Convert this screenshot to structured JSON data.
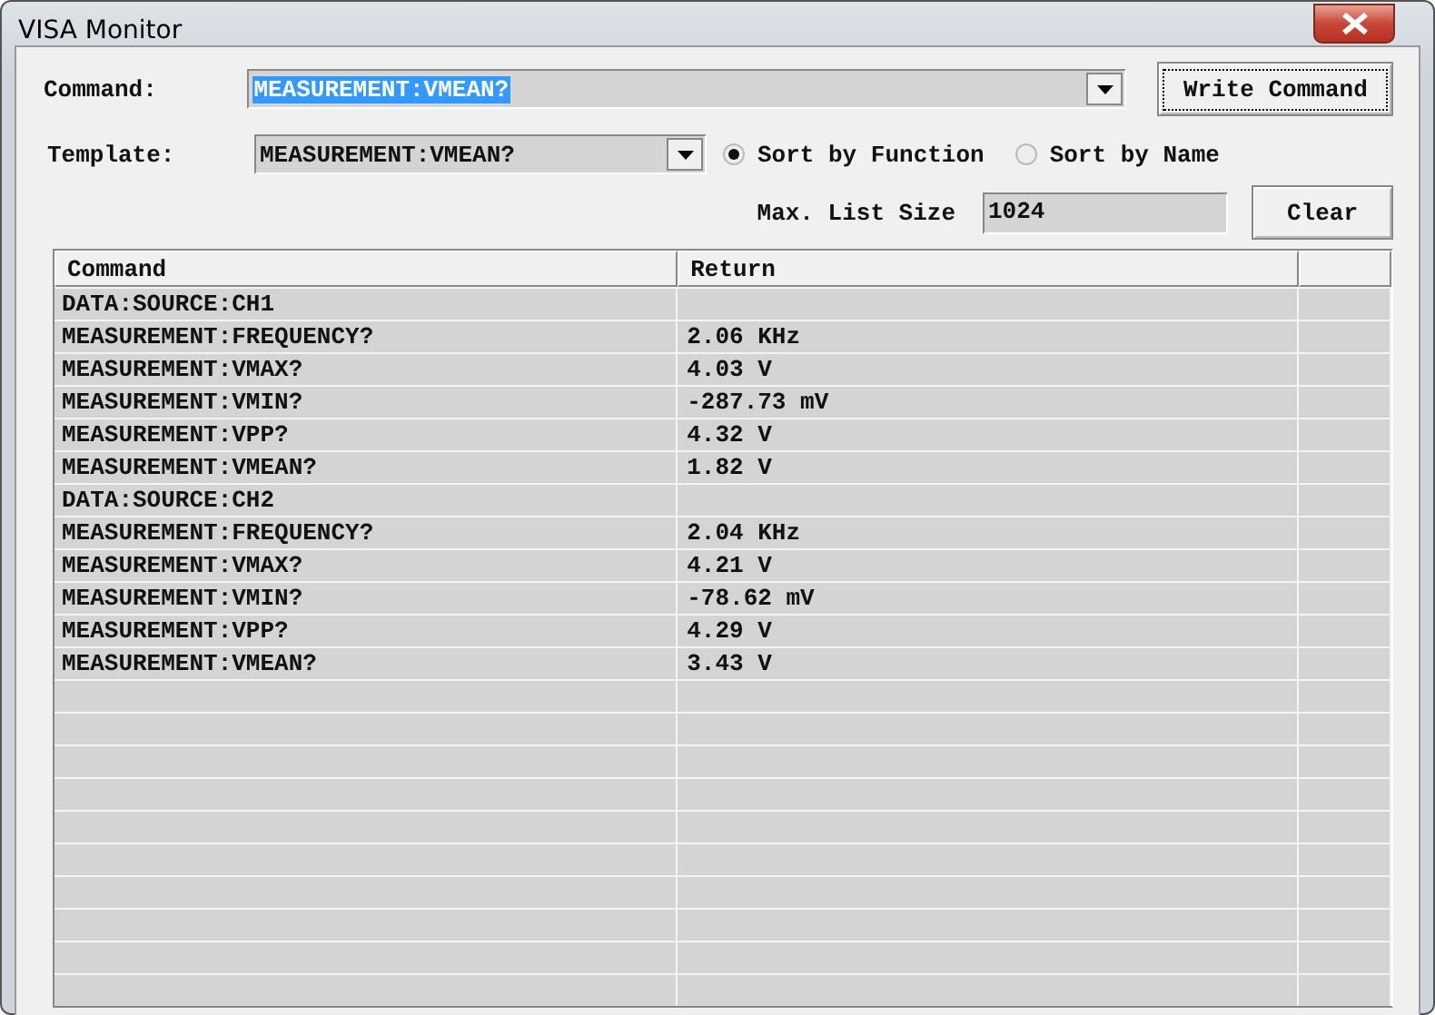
{
  "window": {
    "title": "VISA Monitor"
  },
  "command": {
    "label": "Command:",
    "value": "MEASUREMENT:VMEAN?"
  },
  "write_button": "Write Command",
  "template": {
    "label": "Template:",
    "value": "MEASUREMENT:VMEAN?"
  },
  "sort_options": [
    {
      "label": "Sort by Function",
      "selected": true
    },
    {
      "label": "Sort by Name",
      "selected": false
    }
  ],
  "max_list_size": {
    "label": "Max. List Size",
    "value": "1024"
  },
  "clear_button": "Clear",
  "table": {
    "columns": [
      "Command",
      "Return"
    ],
    "rows": [
      [
        "DATA:SOURCE:CH1",
        ""
      ],
      [
        "MEASUREMENT:FREQUENCY?",
        "2.06 KHz"
      ],
      [
        "MEASUREMENT:VMAX?",
        "4.03 V"
      ],
      [
        "MEASUREMENT:VMIN?",
        "-287.73 mV"
      ],
      [
        "MEASUREMENT:VPP?",
        "4.32 V"
      ],
      [
        "MEASUREMENT:VMEAN?",
        "1.82 V"
      ],
      [
        "DATA:SOURCE:CH2",
        ""
      ],
      [
        "MEASUREMENT:FREQUENCY?",
        "2.04 KHz"
      ],
      [
        "MEASUREMENT:VMAX?",
        "4.21 V"
      ],
      [
        "MEASUREMENT:VMIN?",
        "-78.62 mV"
      ],
      [
        "MEASUREMENT:VPP?",
        "4.29 V"
      ],
      [
        "MEASUREMENT:VMEAN?",
        "3.43 V"
      ]
    ]
  }
}
